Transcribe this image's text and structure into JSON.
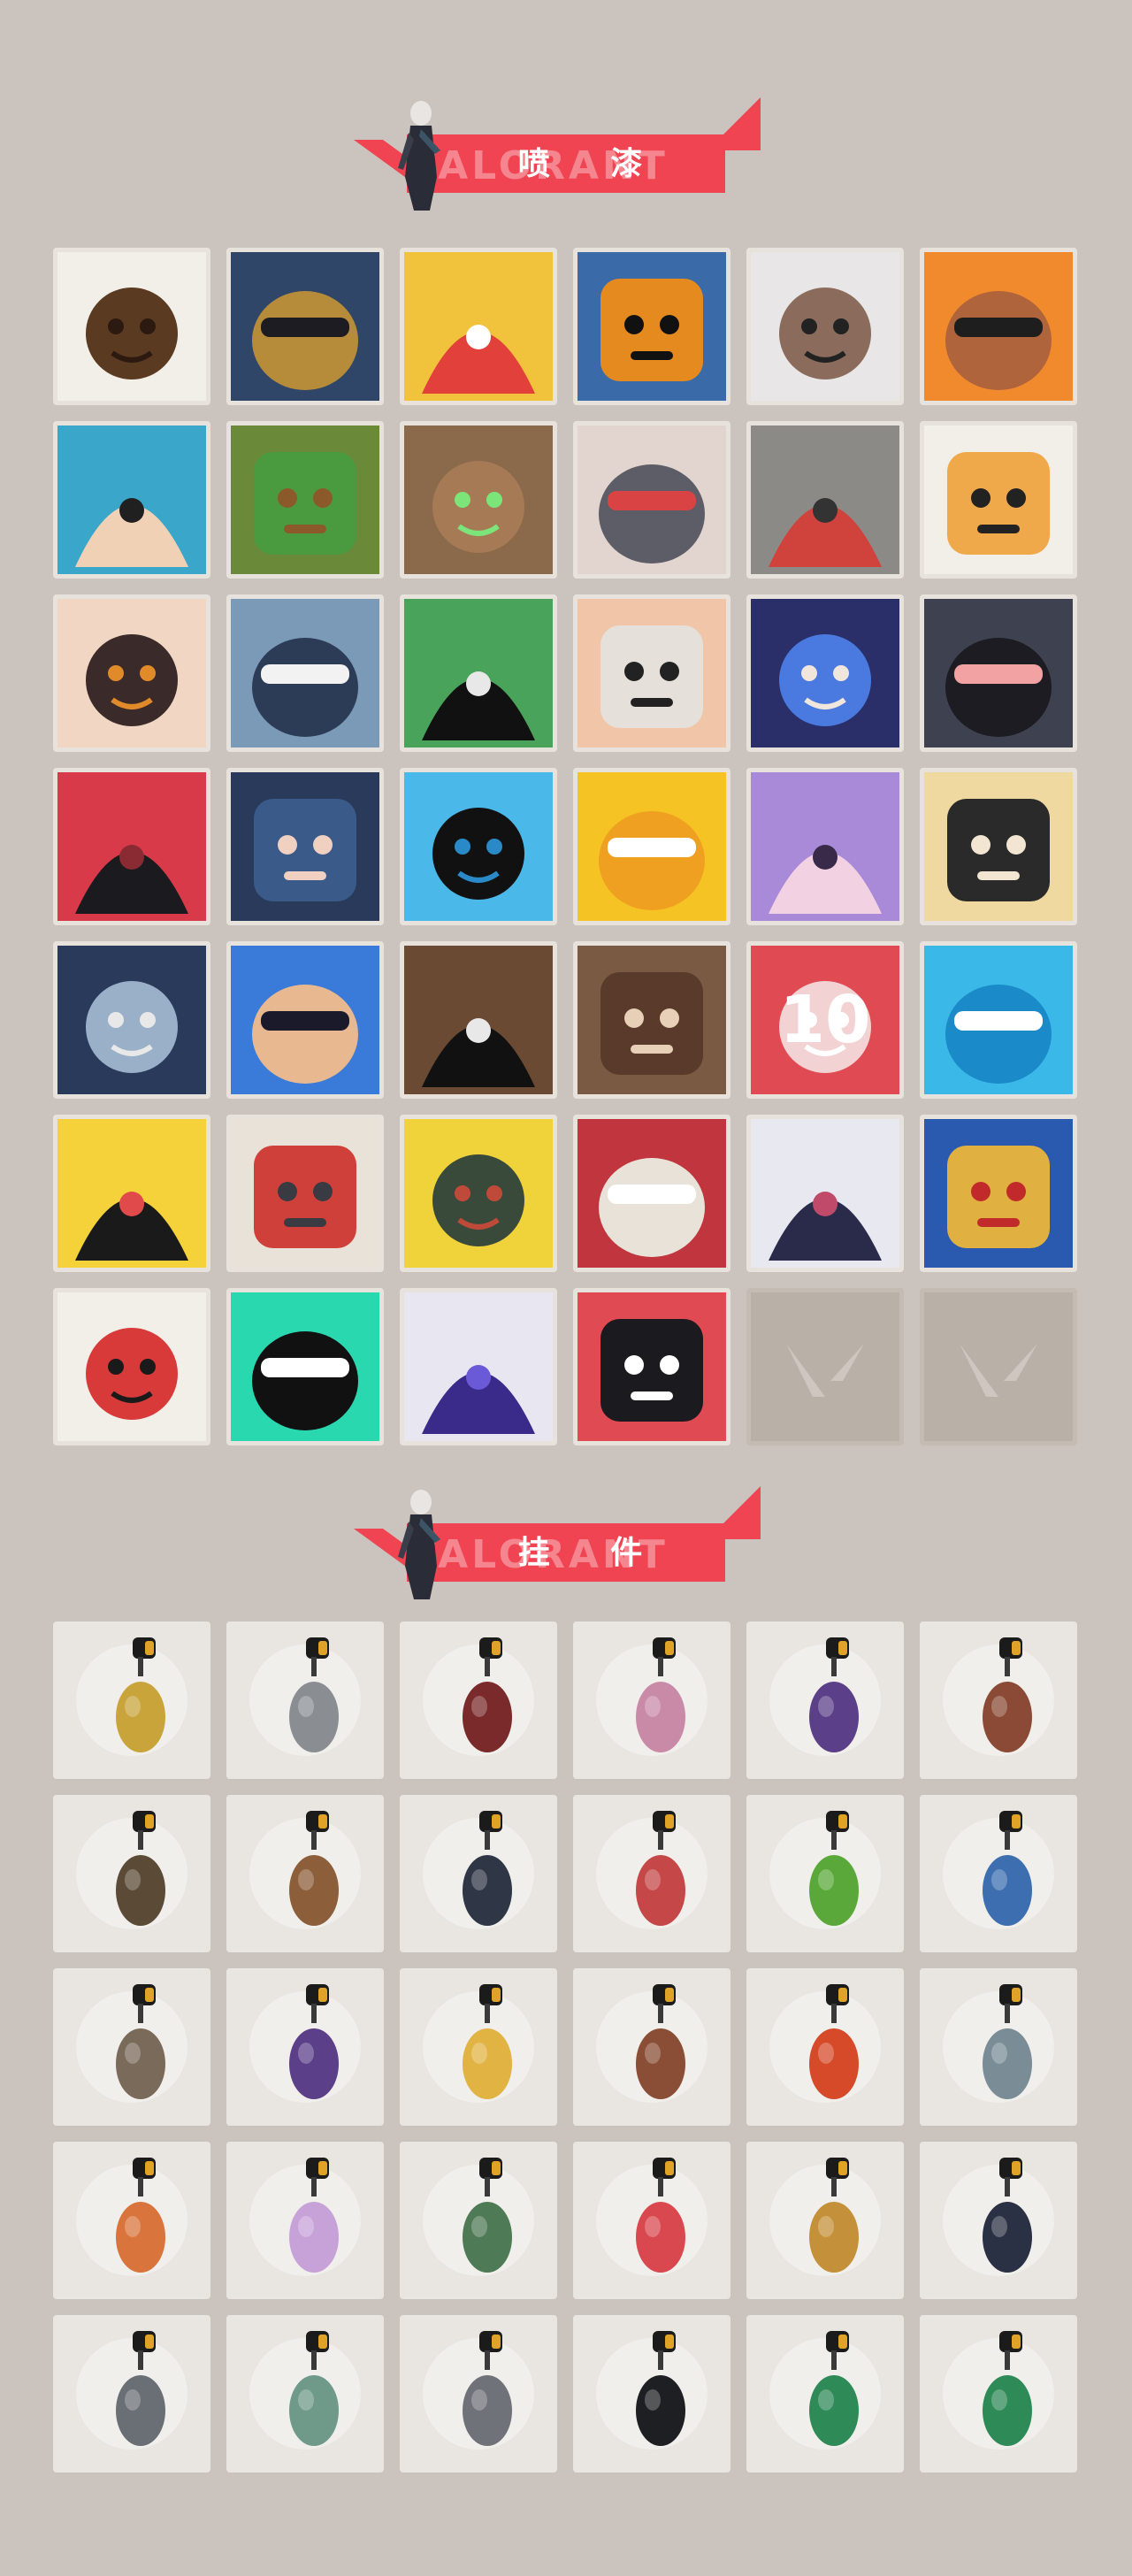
{
  "sections": {
    "sprays": {
      "title": "喷 漆",
      "bg_word": "VALORANT"
    },
    "charms": {
      "title": "挂 件",
      "bg_word": "VALORANT"
    }
  },
  "colors": {
    "page_bg": "#cbc3be",
    "accent": "#f04452",
    "tile_bg": "#ece9e4",
    "empty_tile": "#b9b0a8"
  },
  "sprays": [
    {
      "icon": "pixel-mohawk-agent-icon"
    },
    {
      "icon": "armored-robot-visor-icon"
    },
    {
      "icon": "clown-face-icon"
    },
    {
      "icon": "top-hat-icon"
    },
    {
      "icon": "sunglasses-raccoon-icon"
    },
    {
      "icon": "turban-gunner-icon"
    },
    {
      "icon": "bruised-anime-boy-icon"
    },
    {
      "icon": "green-crate-icon"
    },
    {
      "icon": "green-eyed-creature-icon"
    },
    {
      "icon": "crying-blob-red-cap-icon"
    },
    {
      "icon": "cake-slice-icon"
    },
    {
      "icon": "tiger-icon"
    },
    {
      "icon": "pencil-girl-icon"
    },
    {
      "icon": "penguin-beanie-icon"
    },
    {
      "icon": "frog-magician-icon"
    },
    {
      "icon": "bored-face-icon"
    },
    {
      "icon": "smirking-agent-icon"
    },
    {
      "icon": "laughing-cat-icon"
    },
    {
      "icon": "open-mouth-closeup-icon"
    },
    {
      "icon": "hooded-girl-icon"
    },
    {
      "icon": "blue-flame-mask-icon"
    },
    {
      "icon": "gold-star-icon"
    },
    {
      "icon": "winking-girl-icon"
    },
    {
      "icon": "blonde-agent-icon"
    },
    {
      "icon": "pixel-sloth-gun-icon"
    },
    {
      "icon": "grinning-girl-icon"
    },
    {
      "icon": "sunglasses-grin-icon"
    },
    {
      "icon": "bearded-man-icon"
    },
    {
      "icon": "ten-counter-icon",
      "text": "10"
    },
    {
      "icon": "blue-orb-icon"
    },
    {
      "icon": "yellow-chick-icon"
    },
    {
      "icon": "bandana-blob-icon"
    },
    {
      "icon": "grenade-hands-icon"
    },
    {
      "icon": "red-x-button-icon"
    },
    {
      "icon": "dancer-girl-icon"
    },
    {
      "icon": "shouting-mask-icon"
    },
    {
      "icon": "red-card-girl-icon"
    },
    {
      "icon": "valorant-logo-glitch-icon"
    },
    {
      "icon": "graffiti-tag-icon"
    },
    {
      "icon": "red-angry-face-icon"
    },
    {
      "icon": "empty-slot-icon",
      "empty": true
    },
    {
      "icon": "empty-slot-icon",
      "empty": true
    }
  ],
  "charms": [
    {
      "icon": "gold-bear-charm-icon",
      "color": "#c9a43b"
    },
    {
      "icon": "toaster-charm-icon",
      "color": "#8a8e93"
    },
    {
      "icon": "beaded-rope-charm-icon",
      "color": "#7a2a2a"
    },
    {
      "icon": "cupcake-charm-icon",
      "color": "#c98aa8"
    },
    {
      "icon": "ep9-badge-charm-icon",
      "color": "#5b3f88"
    },
    {
      "icon": "teddy-bear-charm-icon",
      "color": "#8a4a35"
    },
    {
      "icon": "backpack-charm-icon",
      "color": "#5a4a36"
    },
    {
      "icon": "crate-charm-icon",
      "color": "#8d5e3a"
    },
    {
      "icon": "robot-charm-icon",
      "color": "#2f3646"
    },
    {
      "icon": "lava-lamp-charm-icon",
      "color": "#c54747"
    },
    {
      "icon": "green-pager-charm-icon",
      "color": "#5aa83a"
    },
    {
      "icon": "astronaut-charm-icon",
      "color": "#3d6fb0"
    },
    {
      "icon": "radio-charm-icon",
      "color": "#7a6a5a"
    },
    {
      "icon": "ep9-badge-charm-icon",
      "color": "#5b3f88"
    },
    {
      "icon": "cheese-charm-icon",
      "color": "#e0b343"
    },
    {
      "icon": "ice-pop-charm-icon",
      "color": "#8a4d35"
    },
    {
      "icon": "skewer-charm-icon",
      "color": "#d64a2a"
    },
    {
      "icon": "figurine-charm-icon",
      "color": "#7a8c96"
    },
    {
      "icon": "hot-air-balloon-charm-icon",
      "color": "#d9743c"
    },
    {
      "icon": "pastel-figure-charm-icon",
      "color": "#c7a2d8"
    },
    {
      "icon": "turret-charm-icon",
      "color": "#4f7a56"
    },
    {
      "icon": "watermelon-charm-icon",
      "color": "#d9484f"
    },
    {
      "icon": "beehive-charm-icon",
      "color": "#c4913a"
    },
    {
      "icon": "ep9-badge-charm-icon",
      "color": "#2b3144"
    },
    {
      "icon": "swirl-orb-charm-icon",
      "color": "#6a6f76"
    },
    {
      "icon": "ufo-charm-icon",
      "color": "#6f9a8a"
    },
    {
      "icon": "cat-pouch-charm-icon",
      "color": "#6f7278"
    },
    {
      "icon": "valorant-disc-charm-icon",
      "color": "#1d1f22"
    },
    {
      "icon": "green-gem-ep9-charm-icon",
      "color": "#2e8a57"
    },
    {
      "icon": "green-gem-charm-icon",
      "color": "#2e8a57"
    }
  ]
}
